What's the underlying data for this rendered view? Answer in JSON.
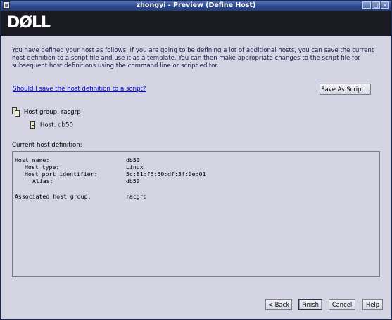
{
  "window": {
    "title": "zhongyi - Preview (Define Host)"
  },
  "banner": {
    "logo_text": "DØLL"
  },
  "intro_text": "You have defined your host as follows.  If you are going to be defining a lot of additional hosts, you can save the current host definition to a script file and use it as a template. You can then make appropriate changes to the script file for subsequent host definitions using the command line or script editor.",
  "save_link": "Should I save the host definition to a script?",
  "save_button": "Save As Script...",
  "tree": {
    "group_label": "Host group: racgrp",
    "host_label": "Host: db50"
  },
  "current_label": "Current host definition:",
  "definition": {
    "host_name_label": "Host name:",
    "host_name_value": "db50",
    "host_type_label": "Host type:",
    "host_type_value": "Linux",
    "port_id_label": "Host port identifier:",
    "port_id_value": "5c:81:f6:60:df:3f:0e:01",
    "alias_label": "Alias:",
    "alias_value": "db50",
    "assoc_group_label": "Associated host group:",
    "assoc_group_value": "racgrp"
  },
  "buttons": {
    "back": "< Back",
    "finish": "Finish",
    "cancel": "Cancel",
    "help": "Help"
  }
}
